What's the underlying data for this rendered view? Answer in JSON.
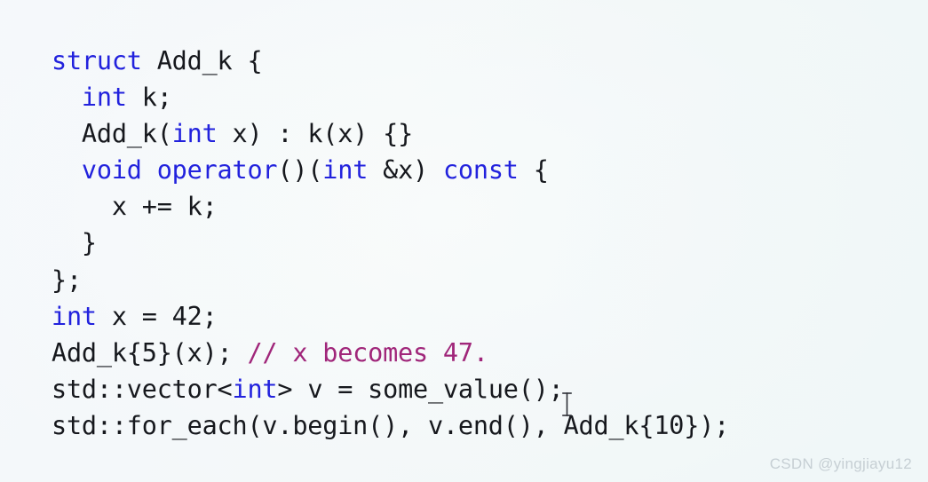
{
  "slide": {
    "background_color": "#f4f8f9",
    "language": "cpp",
    "keyword_color": "#2222dd",
    "comment_color": "#a0267a",
    "text_color": "#16181d"
  },
  "code": {
    "lines": [
      {
        "indent": "",
        "tokens": [
          {
            "text": "struct",
            "type": "keyword"
          },
          {
            "text": " Add_k {",
            "type": "plain"
          }
        ]
      },
      {
        "indent": "  ",
        "tokens": [
          {
            "text": "int",
            "type": "keyword"
          },
          {
            "text": " k;",
            "type": "plain"
          }
        ]
      },
      {
        "indent": "  ",
        "tokens": [
          {
            "text": "Add_k(",
            "type": "plain"
          },
          {
            "text": "int",
            "type": "keyword"
          },
          {
            "text": " x) : k(x) {}",
            "type": "plain"
          }
        ]
      },
      {
        "indent": "  ",
        "tokens": [
          {
            "text": "void operator",
            "type": "keyword"
          },
          {
            "text": "()(",
            "type": "plain"
          },
          {
            "text": "int",
            "type": "keyword"
          },
          {
            "text": " &x) ",
            "type": "plain"
          },
          {
            "text": "const",
            "type": "keyword"
          },
          {
            "text": " {",
            "type": "plain"
          }
        ]
      },
      {
        "indent": "    ",
        "tokens": [
          {
            "text": "x += k;",
            "type": "plain"
          }
        ]
      },
      {
        "indent": "  ",
        "tokens": [
          {
            "text": "}",
            "type": "plain"
          }
        ]
      },
      {
        "indent": "",
        "tokens": [
          {
            "text": "};",
            "type": "plain"
          }
        ]
      },
      {
        "indent": "",
        "tokens": [
          {
            "text": "int",
            "type": "keyword"
          },
          {
            "text": " x = 42;",
            "type": "plain"
          }
        ]
      },
      {
        "indent": "",
        "tokens": [
          {
            "text": "Add_k{5}(x); ",
            "type": "plain"
          },
          {
            "text": "// x becomes 47.",
            "type": "comment"
          }
        ]
      },
      {
        "indent": "",
        "tokens": [
          {
            "text": "std::vector<",
            "type": "plain"
          },
          {
            "text": "int",
            "type": "keyword"
          },
          {
            "text": "> v = some_value();",
            "type": "plain"
          }
        ]
      },
      {
        "indent": "",
        "tokens": [
          {
            "text": "std::for_each(v.begin(), v.end(), Add_k{10});",
            "type": "plain"
          }
        ]
      }
    ],
    "plain_text": "struct Add_k {\n  int k;\n  Add_k(int x) : k(x) {}\n  void operator()(int &x) const {\n    x += k;\n  }\n};\nint x = 42;\nAdd_k{5}(x); // x becomes 47.\nstd::vector<int> v = some_value();\nstd::for_each(v.begin(), v.end(), Add_k{10});"
  },
  "cursor": {
    "type": "text-ibeam",
    "color": "#2d2f36"
  },
  "watermark": {
    "text": "CSDN @yingjiayu12",
    "color": "#c6cfd4"
  }
}
